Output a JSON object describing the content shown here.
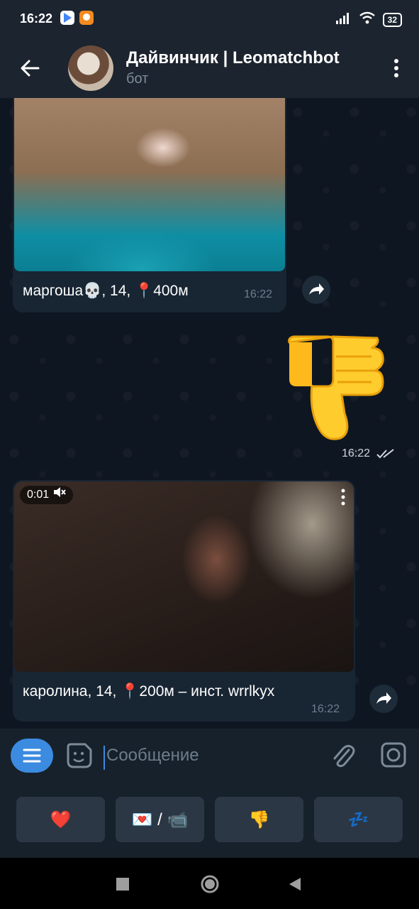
{
  "status_bar": {
    "time": "16:22",
    "battery": "32"
  },
  "header": {
    "title": "Дайвинчик | Leomatchbot",
    "subtitle": "бот"
  },
  "messages": [
    {
      "caption": "маргоша💀, 14, 📍400м",
      "time": "16:22"
    },
    {
      "type": "sticker",
      "emoji": "👎",
      "time": "16:22"
    },
    {
      "caption": "каролина, 14, 📍200м – инст. wrrlkyx",
      "time": "16:22",
      "video_badge": "0:01"
    }
  ],
  "input": {
    "placeholder": "Сообщение"
  },
  "keyboard": {
    "buttons": [
      "❤️",
      "💌 / 📹",
      "👎",
      "💤"
    ]
  },
  "colors": {
    "accent": "#3b8be0",
    "bubble": "#182533",
    "background": "#0e1621"
  }
}
